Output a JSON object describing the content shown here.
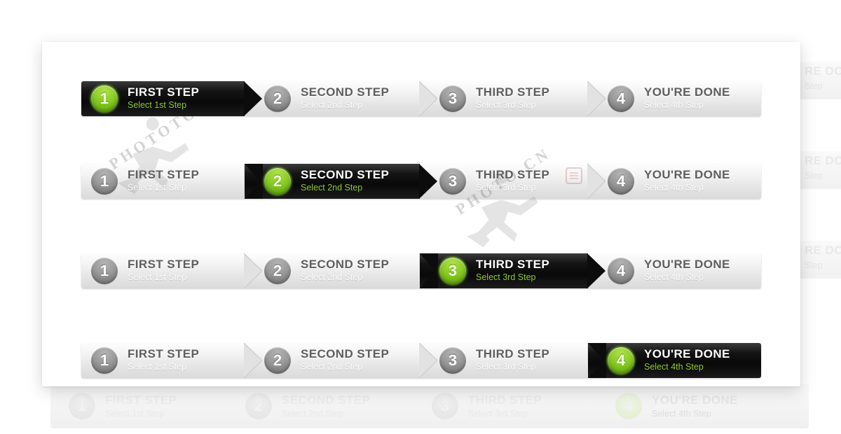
{
  "meta": {
    "component_name": "Breadcrumb Step Navigation",
    "canvas_background": "#ffffff",
    "card_background": "#ffffff",
    "accent_green": "#8dce28",
    "active_black": "#0c0c0c",
    "inactive_silver": "#e7e7e7"
  },
  "steps": [
    {
      "number": "1",
      "title": "FIRST STEP",
      "subtitle": "Select 1st Step"
    },
    {
      "number": "2",
      "title": "SECOND STEP",
      "subtitle": "Select 2nd Step"
    },
    {
      "number": "3",
      "title": "THIRD STEP",
      "subtitle": "Select 3rd Step"
    },
    {
      "number": "4",
      "title": "YOU'RE DONE",
      "subtitle": "Select 4th Step"
    }
  ],
  "rows": [
    {
      "label": "row-active-step-1",
      "active_index": 0
    },
    {
      "label": "row-active-step-2",
      "active_index": 1
    },
    {
      "label": "row-active-step-3",
      "active_index": 2
    },
    {
      "label": "row-active-step-4",
      "active_index": 3
    }
  ],
  "watermarks": [
    {
      "text": "PHOTOTO.CN"
    },
    {
      "text": "PHOTO.CN"
    }
  ],
  "ghost_right": [
    {
      "title": "RE DO",
      "subtitle": "Step"
    },
    {
      "title": "RE DO",
      "subtitle": "Step"
    },
    {
      "title": "RE DO",
      "subtitle": "Step"
    }
  ],
  "ghost_bottom": [
    {
      "number": "1",
      "title": "FIRST STEP",
      "subtitle": "Select 1st Step"
    },
    {
      "number": "2",
      "title": "SECOND STEP",
      "subtitle": "Select 2nd Step"
    },
    {
      "number": "3",
      "title": "THIRD STEP",
      "subtitle": "Select 3rd Step"
    },
    {
      "number": "4",
      "title": "YOU'RE DONE",
      "subtitle": "Select 4th Step"
    }
  ]
}
